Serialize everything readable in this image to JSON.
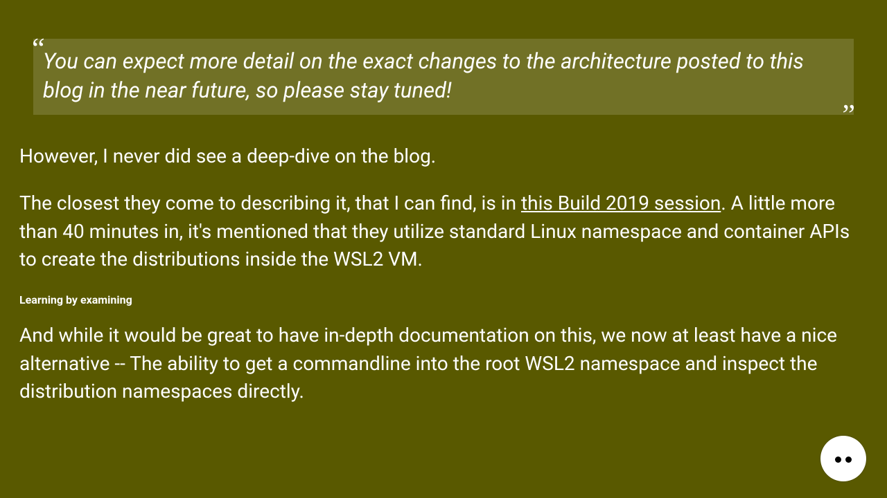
{
  "blockquote": {
    "text": "You can expect more detail on the exact changes to the architecture posted to this blog in the near future, so please stay tuned!"
  },
  "paragraphs": {
    "p1": "However, I never did see a deep-dive on the blog.",
    "p2_pre": "The closest they come to describing it, that I can find, is in ",
    "p2_link": "this Build 2019 session",
    "p2_post": ". A little more than 40 minutes in, it's mentioned that they utilize standard Linux namespace and container APIs to create the distributions inside the WSL2 VM."
  },
  "subheading": "Learning by examining",
  "paragraph3": "And while it would be great to have in-depth documentation on this, we now at least have a nice alternative -- The ability to get a commandline into the root WSL2 namespace and inspect the distribution namespaces directly.",
  "quote_glyphs": {
    "open": "“",
    "close": "”"
  }
}
